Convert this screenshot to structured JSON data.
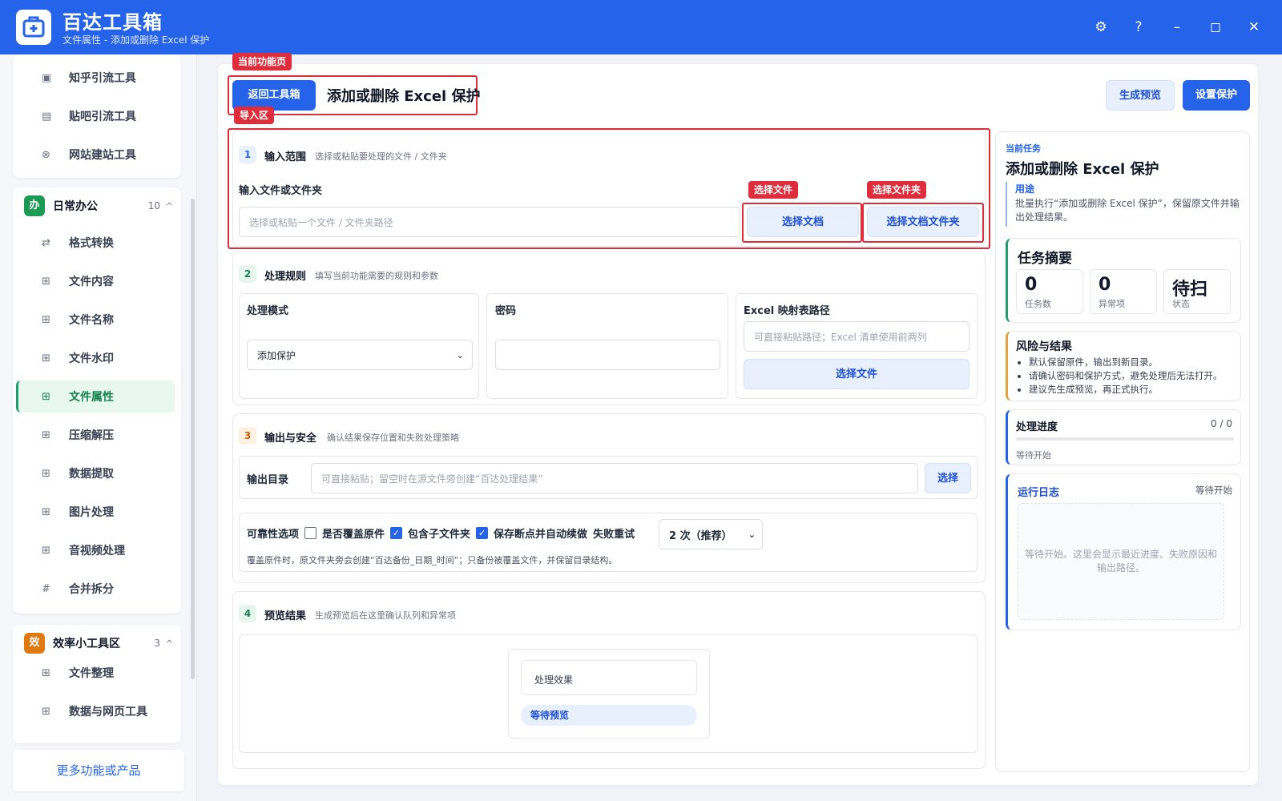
{
  "app": {
    "title": "百达工具箱",
    "subtitle": "文件属性 - 添加或删除 Excel 保护"
  },
  "window": {
    "settings": "⚙",
    "help": "?",
    "minimize": "–",
    "maximize": "◻",
    "close": "✕"
  },
  "colors": {
    "brand": "#2563eb",
    "active_green": "#22a06b",
    "alert_red": "#e02d3c",
    "office_badge": "#1a9a52",
    "efficiency_badge": "#e07a10"
  },
  "sidebar": {
    "top_items": [
      {
        "icon": "▣",
        "label": "知乎引流工具"
      },
      {
        "icon": "▤",
        "label": "贴吧引流工具"
      },
      {
        "icon": "⊗",
        "label": "网站建站工具"
      }
    ],
    "group_office": {
      "badge": "办",
      "name": "日常办公",
      "count": "10",
      "chevron": "^"
    },
    "office_items": [
      {
        "icon": "⇄",
        "label": "格式转换"
      },
      {
        "icon": "⊞",
        "label": "文件内容"
      },
      {
        "icon": "⊞",
        "label": "文件名称"
      },
      {
        "icon": "⊞",
        "label": "文件水印"
      },
      {
        "icon": "⊞",
        "label": "文件属性"
      },
      {
        "icon": "⊞",
        "label": "压缩解压"
      },
      {
        "icon": "⊞",
        "label": "数据提取"
      },
      {
        "icon": "⊞",
        "label": "图片处理"
      },
      {
        "icon": "⊞",
        "label": "音视频处理"
      },
      {
        "icon": "#",
        "label": "合并拆分"
      }
    ],
    "group_efficiency": {
      "badge": "效",
      "name": "效率小工具区",
      "count": "3",
      "chevron": "^"
    },
    "efficiency_items": [
      {
        "icon": "⊞",
        "label": "文件整理"
      },
      {
        "icon": "⊞",
        "label": "数据与网页工具"
      }
    ],
    "more_link": "更多功能或产品"
  },
  "header": {
    "tag_current": "当前功能页",
    "back_button": "返回工具箱",
    "page_title": "添加或删除 Excel 保护",
    "preview_button": "生成预览",
    "run_button": "设置保护"
  },
  "tags": {
    "import": "导入区",
    "select_file": "选择文件",
    "select_folder": "选择文件夹"
  },
  "step1": {
    "num": "1",
    "title": "输入范围",
    "desc": "选择或粘贴要处理的文件 / 文件夹",
    "field_label": "输入文件或文件夹",
    "placeholder": "选择或粘贴一个文件 / 文件夹路径",
    "btn_file": "选择文档",
    "btn_folder": "选择文档文件夹"
  },
  "step2": {
    "num": "2",
    "title": "处理规则",
    "desc": "填写当前功能需要的规则和参数",
    "mode_label": "处理模式",
    "mode_value": "添加保护",
    "password_label": "密码",
    "mapping_label": "Excel 映射表路径",
    "mapping_placeholder": "可直接粘贴路径；Excel 清单使用前两列",
    "mapping_button": "选择文件"
  },
  "step3": {
    "num": "3",
    "title": "输出与安全",
    "desc": "确认结果保存位置和失败处理策略",
    "output_label": "输出目录",
    "output_placeholder": "可直接粘贴；留空时在源文件旁创建“百达处理结果”",
    "output_button": "选择",
    "reliability_label": "可靠性选项",
    "opt_overwrite": "是否覆盖原件",
    "opt_subfolder": "包含子文件夹",
    "opt_resume": "保存断点并自动续做",
    "retry_label": "失败重试",
    "retry_value": "2 次（推荐）",
    "note": "覆盖原件时，原文件夹旁会创建“百达备份_日期_时间”；只备份被覆盖文件，并保留目录结构。"
  },
  "step4": {
    "num": "4",
    "title": "预览结果",
    "desc": "生成预览后在这里确认队列和异常项",
    "effect_label": "处理效果",
    "status_pill": "等待预览"
  },
  "right": {
    "task_kicker": "当前任务",
    "task_title": "添加或删除 Excel 保护",
    "usage_label": "用途",
    "usage_text": "批量执行“添加或删除 Excel 保护”，保留原文件并输出处理结果。",
    "summary_title": "任务摘要",
    "stats": [
      {
        "value": "0",
        "label": "任务数"
      },
      {
        "value": "0",
        "label": "异常项"
      },
      {
        "value": "待扫",
        "label": "状态"
      }
    ],
    "risk_title": "风险与结果",
    "risks": [
      "默认保留原件，输出到新目录。",
      "请确认密码和保护方式，避免处理后无法打开。",
      "建议先生成预览，再正式执行。"
    ],
    "progress_title": "处理进度",
    "progress_count": "0 / 0",
    "progress_fraction": 0,
    "progress_status": "等待开始",
    "log_title": "运行日志",
    "log_status": "等待开始",
    "log_text": "等待开始。这里会显示最近进度、失败原因和输出路径。"
  }
}
